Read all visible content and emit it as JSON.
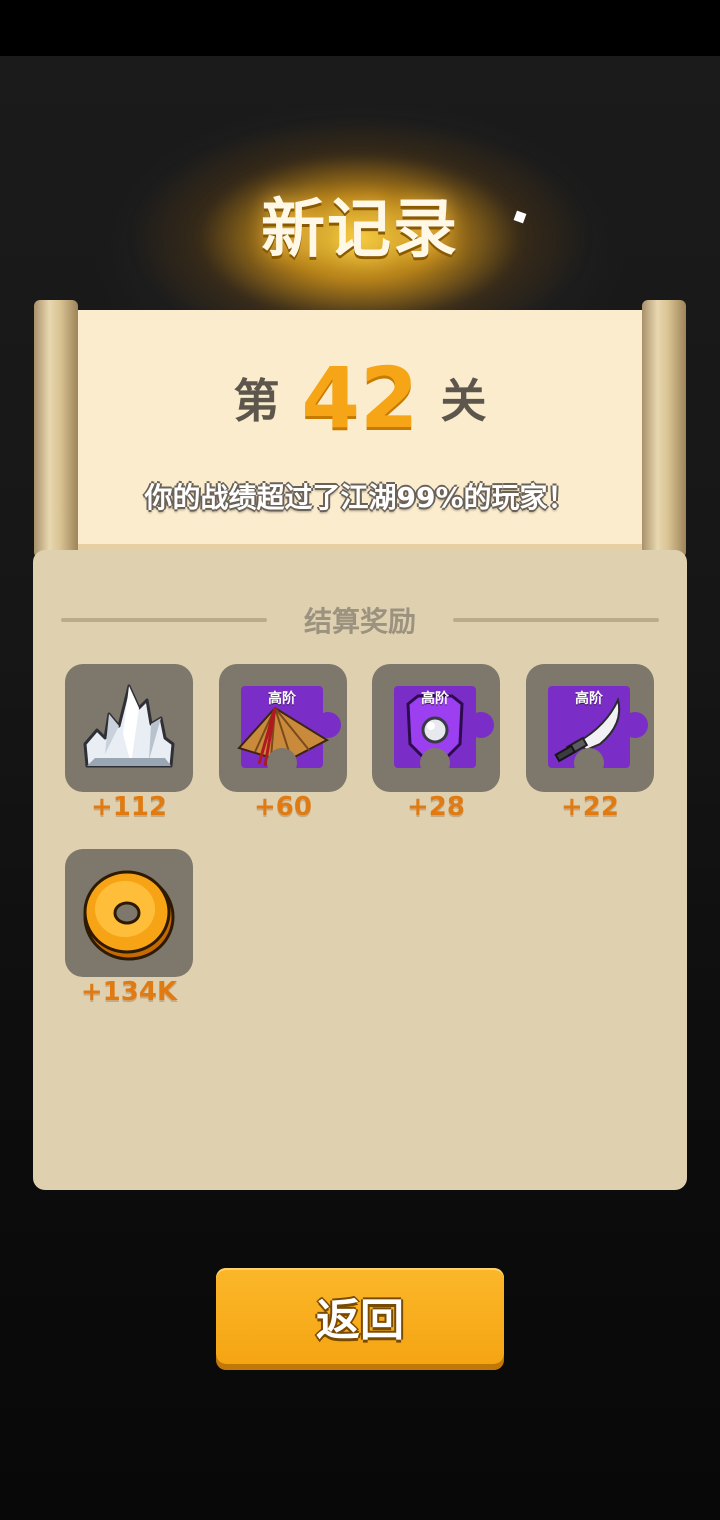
{
  "header": {
    "title": "新记录"
  },
  "level": {
    "prefix": "第",
    "number": "42",
    "suffix": "关"
  },
  "result": {
    "message": "你的战绩超过了江湖99%的玩家！"
  },
  "rewards": {
    "title": "结算奖励",
    "items": [
      {
        "icon": "silver-crystal-icon",
        "amount": "+112",
        "tier": ""
      },
      {
        "icon": "bamboo-hat-fragment-icon",
        "amount": "+60",
        "tier": "高阶"
      },
      {
        "icon": "armor-fragment-icon",
        "amount": "+28",
        "tier": "高阶"
      },
      {
        "icon": "saber-fragment-icon",
        "amount": "+22",
        "tier": "高阶"
      },
      {
        "icon": "gold-coin-icon",
        "amount": "+134K",
        "tier": ""
      }
    ]
  },
  "actions": {
    "return_label": "返回"
  },
  "colors": {
    "accent": "#F5A516",
    "fragment": "#7A2EC7",
    "amount": "#E07B14"
  }
}
